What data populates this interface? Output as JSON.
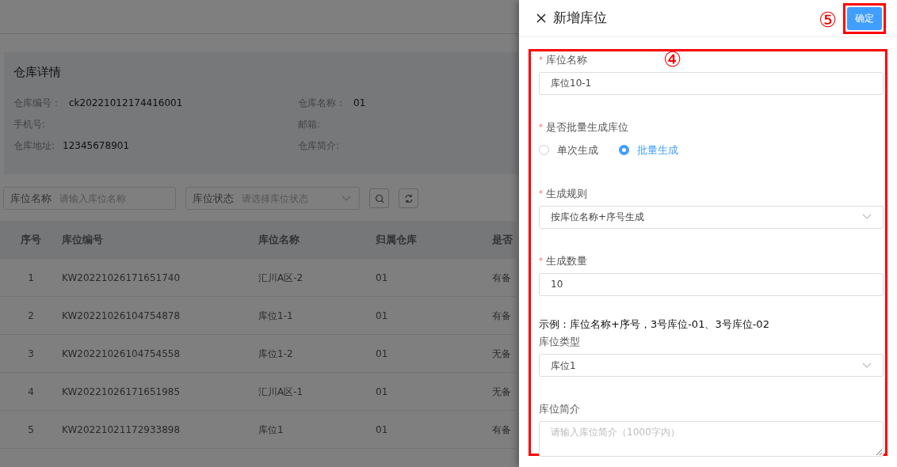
{
  "warehouse_detail": {
    "title": "仓库详情",
    "fields": [
      {
        "label": "仓库编号：",
        "value": "ck20221012174416001"
      },
      {
        "label": "仓库名称：",
        "value": "01"
      },
      {
        "label": "手机号:"
      },
      {
        "label": "邮箱:"
      },
      {
        "label": "仓库地址:",
        "value": "12345678901"
      },
      {
        "label": "仓库简介:"
      }
    ]
  },
  "filters": [
    {
      "kind": "input",
      "label": "库位名称",
      "placeholder": "请输入库位名称"
    },
    {
      "kind": "select",
      "label": "库位状态",
      "placeholder": "请选择库位状态"
    }
  ],
  "table": {
    "columns": [
      "序号",
      "库位编号",
      "库位名称",
      "归属仓库",
      "是否"
    ],
    "rows": [
      [
        "1",
        "KW20221026171651740",
        "汇川A区-2",
        "01",
        "有备"
      ],
      [
        "2",
        "KW20221026104754878",
        "库位1-1",
        "01",
        "有备"
      ],
      [
        "3",
        "KW20221026104754558",
        "库位1-2",
        "01",
        "无备"
      ],
      [
        "4",
        "KW20221026171651985",
        "汇川A区-1",
        "01",
        "无备"
      ],
      [
        "5",
        "KW20221021172933898",
        "库位1",
        "01",
        "有备"
      ]
    ]
  },
  "drawer": {
    "title": "新增库位",
    "confirm_button": "确定",
    "form": [
      {
        "kind": "input",
        "label": "库位名称",
        "required_mark": "*",
        "value": "库位10-1"
      },
      {
        "kind": "radio",
        "label": "是否批量生成库位",
        "required_mark": "*",
        "options": [
          {
            "label": "单次生成",
            "selected": false
          },
          {
            "label": "批量生成",
            "selected": true
          }
        ]
      },
      {
        "kind": "select",
        "label": "生成规则",
        "required_mark": "*",
        "value": "按库位名称+序号生成"
      },
      {
        "kind": "input",
        "label": "生成数量",
        "required_mark": "*",
        "value": "10"
      },
      {
        "kind": "note",
        "text": "示例：库位名称+序号，3号库位-01、3号库位-02"
      },
      {
        "kind": "select",
        "label": "库位类型",
        "value": "库位1"
      },
      {
        "kind": "textarea",
        "label": "库位简介",
        "placeholder": "请输入库位简介（1000字内）"
      }
    ]
  },
  "annotations": [
    {
      "label": "④"
    },
    {
      "label": "⑤"
    }
  ]
}
